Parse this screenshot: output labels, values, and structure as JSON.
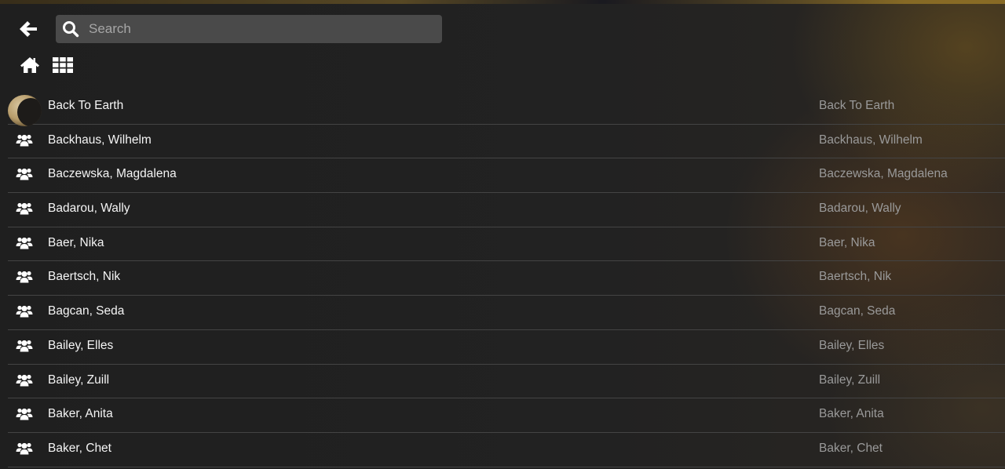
{
  "search": {
    "placeholder": "Search",
    "value": ""
  },
  "nav": {
    "back_icon": "arrow-left-icon",
    "home_icon": "home-icon",
    "grid_icon": "grid-icon"
  },
  "list": {
    "items": [
      {
        "title": "Back To Earth",
        "subtitle": "Back To Earth",
        "icon": "album-thumbnail"
      },
      {
        "title": "Backhaus, Wilhelm",
        "subtitle": "Backhaus, Wilhelm",
        "icon": "users-icon"
      },
      {
        "title": "Baczewska, Magdalena",
        "subtitle": "Baczewska, Magdalena",
        "icon": "users-icon"
      },
      {
        "title": "Badarou, Wally",
        "subtitle": "Badarou, Wally",
        "icon": "users-icon"
      },
      {
        "title": "Baer, Nika",
        "subtitle": "Baer, Nika",
        "icon": "users-icon"
      },
      {
        "title": "Baertsch, Nik",
        "subtitle": "Baertsch, Nik",
        "icon": "users-icon"
      },
      {
        "title": "Bagcan, Seda",
        "subtitle": "Bagcan, Seda",
        "icon": "users-icon"
      },
      {
        "title": "Bailey, Elles",
        "subtitle": "Bailey, Elles",
        "icon": "users-icon"
      },
      {
        "title": "Bailey, Zuill",
        "subtitle": "Bailey, Zuill",
        "icon": "users-icon"
      },
      {
        "title": "Baker, Anita",
        "subtitle": "Baker, Anita",
        "icon": "users-icon"
      },
      {
        "title": "Baker, Chet",
        "subtitle": "Baker, Chet",
        "icon": "users-icon"
      }
    ]
  }
}
